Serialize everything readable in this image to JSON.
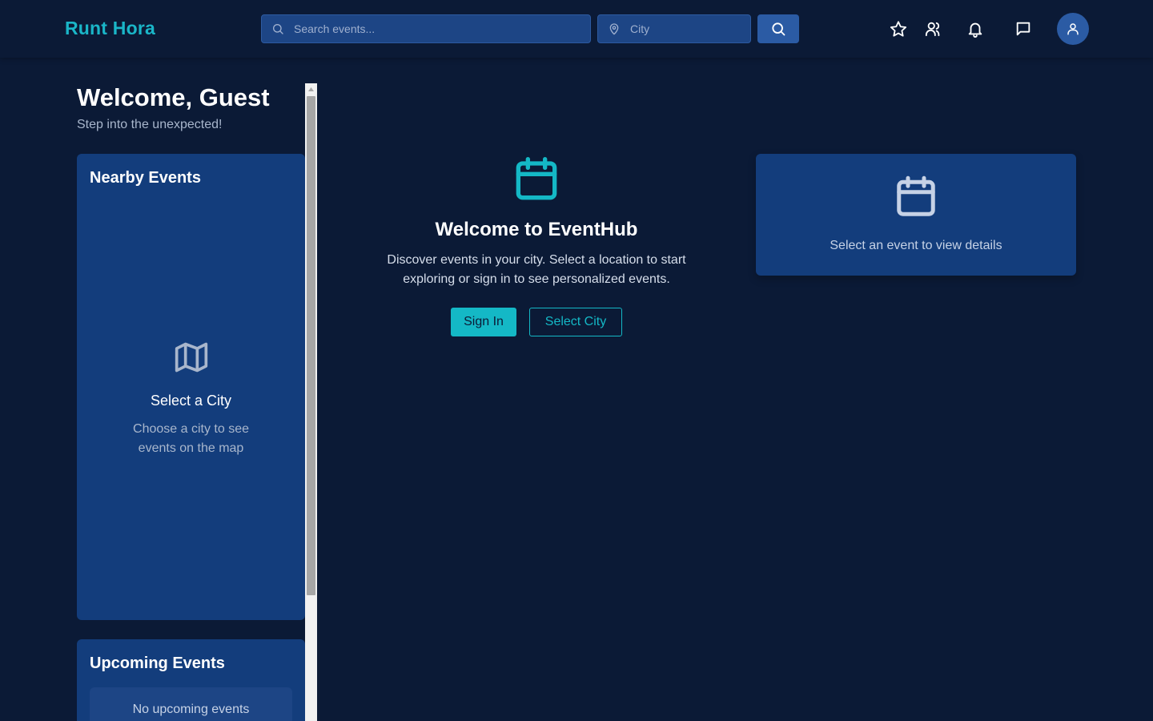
{
  "header": {
    "brand": "Runt Hora",
    "search": {
      "placeholder": "Search events..."
    },
    "city": {
      "placeholder": "City"
    },
    "icons": [
      "search-icon",
      "map-pin-icon",
      "star-icon",
      "users-icon",
      "bell-icon",
      "message-icon",
      "user-icon"
    ]
  },
  "sidebar": {
    "welcome_title": "Welcome, Guest",
    "welcome_subtitle": "Step into the unexpected!",
    "nearby": {
      "title": "Nearby Events",
      "empty_title": "Select a City",
      "empty_text": "Choose a city to see events on the map"
    },
    "upcoming": {
      "title": "Upcoming Events",
      "empty_text": "No upcoming events"
    }
  },
  "main": {
    "title": "Welcome to EventHub",
    "text": "Discover events in your city. Select a location to start exploring or sign in to see personalized events.",
    "signin_label": "Sign In",
    "selectcity_label": "Select City"
  },
  "detail": {
    "text": "Select an event to view details"
  },
  "colors": {
    "background": "#0b1a36",
    "card": "#133d7c",
    "accent": "#14b8c6",
    "input": "#1d4585"
  }
}
